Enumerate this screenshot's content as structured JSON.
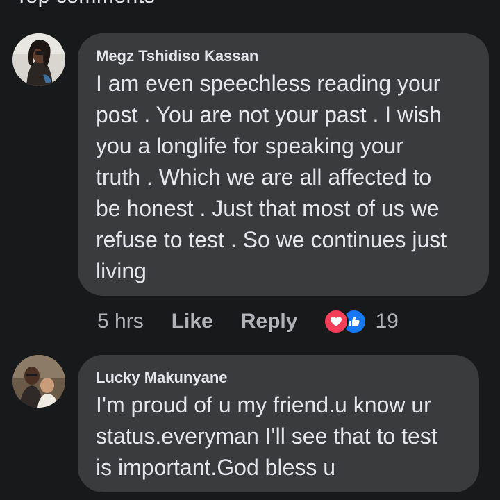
{
  "section": {
    "title": "Top comments"
  },
  "comments": [
    {
      "author": "Megz Tshidiso Kassan",
      "text": "I am even speechless reading your\npost . You are not your past . I wish\nyou a longlife for speaking your\ntruth .  Which we are all affected to\nbe honest . Just that most of us we\nrefuse to test . So we continues just\nliving",
      "time": "5 hrs",
      "like_label": "Like",
      "reply_label": "Reply",
      "reactions": [
        "love-icon",
        "like-icon"
      ],
      "reaction_count": "19"
    },
    {
      "author": "Lucky Makunyane",
      "text": "I'm proud of u my friend.u know ur\nstatus.everyman I'll see that to test\nis important.God bless u"
    }
  ],
  "colors": {
    "background": "#18191a",
    "bubble": "#3a3b3c",
    "text": "#e4e6eb",
    "secondary_text": "#b0b3b8",
    "love": "#f33e58",
    "like": "#1877f2"
  }
}
